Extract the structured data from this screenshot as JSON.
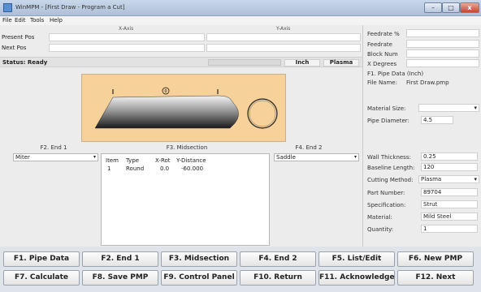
{
  "window": {
    "title": "WinMPM - [First Draw - Program a Cut]",
    "minimize": "–",
    "maximize": "□",
    "close": "x"
  },
  "menu": [
    "File",
    "Edit",
    "Tools",
    "Help"
  ],
  "axes": {
    "x": "X-Axis",
    "y": "Y-Axis"
  },
  "positions": {
    "present": "Present Pos",
    "next": "Next Pos"
  },
  "status": {
    "text": "Status: Ready",
    "unit": "Inch",
    "mode": "Plasma"
  },
  "machine": {
    "feedrate_pct": "Feedrate %",
    "feedrate": "Feedrate",
    "block_num": "Block Num",
    "x_degrees": "X Degrees"
  },
  "pipe": {
    "header": "F1. Pipe Data (Inch)",
    "file_name_label": "File Name:",
    "file_name": "First Draw.pmp",
    "material_size_label": "Material Size:",
    "material_size": "",
    "diameter_label": "Pipe Diameter:",
    "diameter": "4.5",
    "wall_label": "Wall Thickness:",
    "wall": "0.25",
    "baseline_label": "Baseline Length:",
    "baseline": "120",
    "cut_label": "Cutting Method:",
    "cut": "Plasma",
    "part_label": "Part Number:",
    "part": "89704",
    "spec_label": "Specification:",
    "spec": "Strut",
    "material_label": "Material:",
    "material": "Mild Steel",
    "qty_label": "Quantity:",
    "qty": "1"
  },
  "end1": {
    "title": "F2. End 1",
    "value": "Miter"
  },
  "midsection": {
    "title": "F3. Midsection",
    "columns": [
      "Item",
      "Type",
      "X-Rot",
      "Y-Distance"
    ],
    "rows": [
      [
        "1",
        "Round",
        "0.0",
        "-60.000"
      ]
    ]
  },
  "end2": {
    "title": "F4. End 2",
    "value": "Saddle"
  },
  "drawing": {
    "marker": "0"
  },
  "fkeys": [
    "F1. Pipe Data",
    "F2. End 1",
    "F3. Midsection",
    "F4. End 2",
    "F5. List/Edit",
    "F6. New PMP",
    "F7. Calculate",
    "F8. Save PMP",
    "F9. Control Panel",
    "F10. Return",
    "F11. Acknowledge",
    "F12. Next"
  ],
  "colors": {
    "drawing_bg": "#f6d19a",
    "accent": "#5a8ed0"
  }
}
